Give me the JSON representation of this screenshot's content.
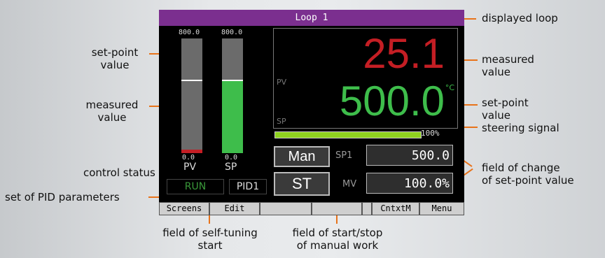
{
  "device": {
    "title": "Loop 1",
    "pv_bar": {
      "scale_max": "800.0",
      "scale_min": "0.0",
      "label": "PV",
      "level": 0.03125,
      "marker": 0.625
    },
    "sp_bar": {
      "scale_max": "800.0",
      "scale_min": "0.0",
      "label": "SP",
      "level": 0.625
    },
    "pv_label": "PV",
    "sp_label": "SP",
    "pv_value": "25.1",
    "sp_value": "500.0",
    "unit": "°C",
    "steering_label": "100%",
    "steering_level": 1.0,
    "man_button": "Man",
    "st_button": "ST",
    "sp1_label": "SP1",
    "sp1_value": "500.0",
    "mv_label": "MV",
    "mv_value": "100.0%",
    "control_status": "RUN",
    "pid_set": "PID1",
    "menu": [
      "Screens",
      "Edit",
      "",
      "",
      "",
      "CntxtM",
      "Menu"
    ]
  },
  "annotations": {
    "displayed_loop": "displayed loop",
    "setpoint_left_1": "set-point",
    "setpoint_left_2": "value",
    "measured_left_1": "measured",
    "measured_left_2": "value",
    "control_status": "control status",
    "pid_params": "set of PID parameters",
    "measured_right_1": "measured",
    "measured_right_2": "value",
    "setpoint_right_1": "set-point",
    "setpoint_right_2": "value",
    "steering": "steering signal",
    "field_change_1": "field of change",
    "field_change_2": "of set-point value",
    "self_tuning_1": "field of self-tuning",
    "self_tuning_2": "start",
    "manual_1": "field of start/stop",
    "manual_2": "of manual work"
  },
  "colors": {
    "accent": "#e8731a",
    "title_bar": "#7b2f8f",
    "pv_red": "#c41e24",
    "sp_green": "#3ebd4b",
    "steering": "#8fd31f"
  }
}
